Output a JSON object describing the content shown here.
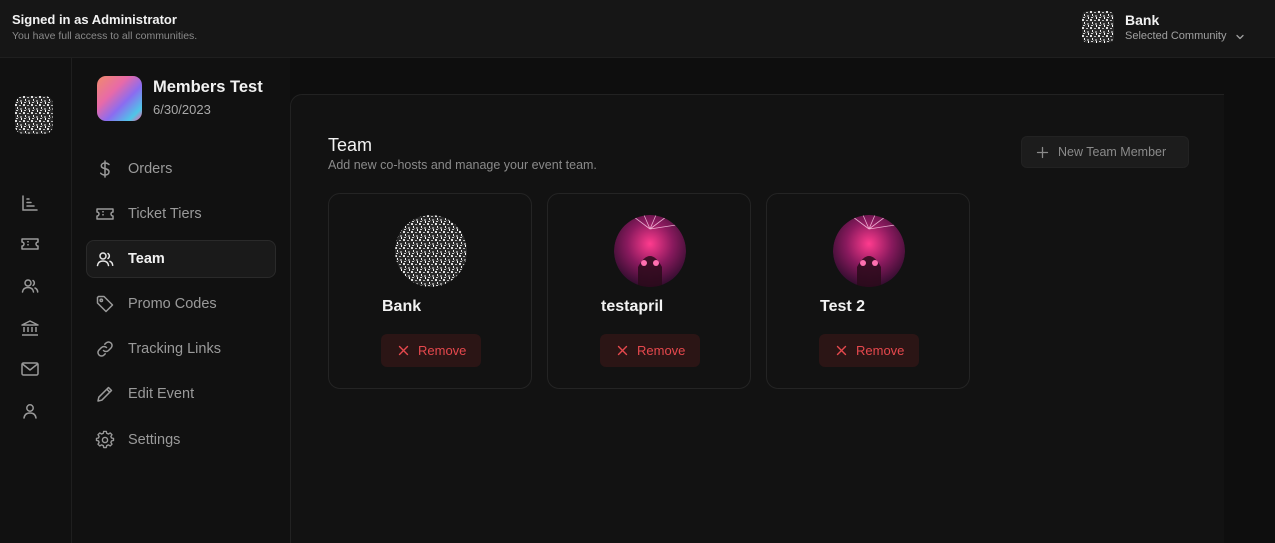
{
  "topbar": {
    "signed_title": "Signed in as Administrator",
    "signed_sub": "You have full access to all communities.",
    "community_name": "Bank",
    "community_sub": "Selected Community"
  },
  "rail": {
    "items": [
      "chart-icon",
      "ticket-icon",
      "users-icon",
      "bank-icon",
      "mail-icon",
      "user-icon"
    ]
  },
  "event": {
    "title": "Members Test",
    "date": "6/30/2023"
  },
  "nav": {
    "items": [
      {
        "label": "Orders",
        "icon": "dollar-icon"
      },
      {
        "label": "Ticket Tiers",
        "icon": "ticket-icon"
      },
      {
        "label": "Team",
        "icon": "users-icon",
        "active": true
      },
      {
        "label": "Promo Codes",
        "icon": "tag-icon"
      },
      {
        "label": "Tracking Links",
        "icon": "link-icon"
      },
      {
        "label": "Edit Event",
        "icon": "pencil-icon"
      },
      {
        "label": "Settings",
        "icon": "gear-icon"
      }
    ]
  },
  "team": {
    "title": "Team",
    "subtitle": "Add new co-hosts and manage your event team.",
    "new_button": "New Team Member",
    "remove_label": "Remove",
    "members": [
      {
        "name": "Bank"
      },
      {
        "name": "testapril"
      },
      {
        "name": "Test 2"
      }
    ]
  },
  "colors": {
    "background": "#0e0e0e",
    "panel": "#121212",
    "danger": "#e5484d",
    "danger_bg": "#2b1515"
  }
}
